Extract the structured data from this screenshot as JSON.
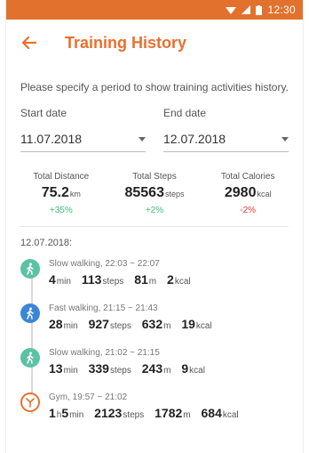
{
  "status_bar": {
    "time": "12:30",
    "icons": [
      "wifi-icon",
      "signal-icon",
      "battery-icon"
    ]
  },
  "app_bar": {
    "title": "Training History",
    "back_icon": "arrow-left-icon"
  },
  "description": "Please specify a period to show training activities history.",
  "start_date": {
    "label": "Start date",
    "value": "11.07.2018"
  },
  "end_date": {
    "label": "End date",
    "value": "12.07.2018"
  },
  "summary": [
    {
      "label": "Total Distance",
      "value": "75.2",
      "unit": "km",
      "change": "+35%"
    },
    {
      "label": "Total Steps",
      "value": "85563",
      "unit": "steps",
      "change": "+2%"
    },
    {
      "label": "Total Calories",
      "value": "2980",
      "unit": "kcal",
      "change": "-2%"
    }
  ],
  "day": "12.07.2018:",
  "activities": [
    {
      "title": "Slow walking, 22:03 ~ 22:07",
      "icon": "walking-icon",
      "metrics": [
        {
          "value": "4",
          "unit": "min"
        },
        {
          "value": "113",
          "unit": "steps"
        },
        {
          "value": "81",
          "unit": "m"
        },
        {
          "value": "2",
          "unit": "kcal"
        }
      ]
    },
    {
      "title": "Fast walking, 21:15 ~ 21:43",
      "icon": "walking-icon",
      "metrics": [
        {
          "value": "28",
          "unit": "min"
        },
        {
          "value": "927",
          "unit": "steps"
        },
        {
          "value": "632",
          "unit": "m"
        },
        {
          "value": "19",
          "unit": "kcal"
        }
      ]
    },
    {
      "title": "Slow walking, 21:02 ~ 21:15",
      "icon": "walking-icon",
      "metrics": [
        {
          "value": "13",
          "unit": "min"
        },
        {
          "value": "339",
          "unit": "steps"
        },
        {
          "value": "243",
          "unit": "m"
        },
        {
          "value": "9",
          "unit": "kcal"
        }
      ]
    },
    {
      "title": "Gym, 19:57 ~ 21:02",
      "icon": "gym-icon",
      "metrics": [
        {
          "value": "1",
          "unit": "h"
        },
        {
          "value": "5",
          "unit": "min"
        },
        {
          "value": "2123",
          "unit": "steps"
        },
        {
          "value": "1782",
          "unit": "m"
        },
        {
          "value": "684",
          "unit": "kcal"
        }
      ]
    }
  ],
  "colors": {
    "accent": "#e8702f",
    "status_bar": "#e2712e",
    "positive": "#3dbd7a",
    "negative": "#e23a2e",
    "slow_walking": "#5cc2a5",
    "fast_walking": "#3b86d6"
  }
}
